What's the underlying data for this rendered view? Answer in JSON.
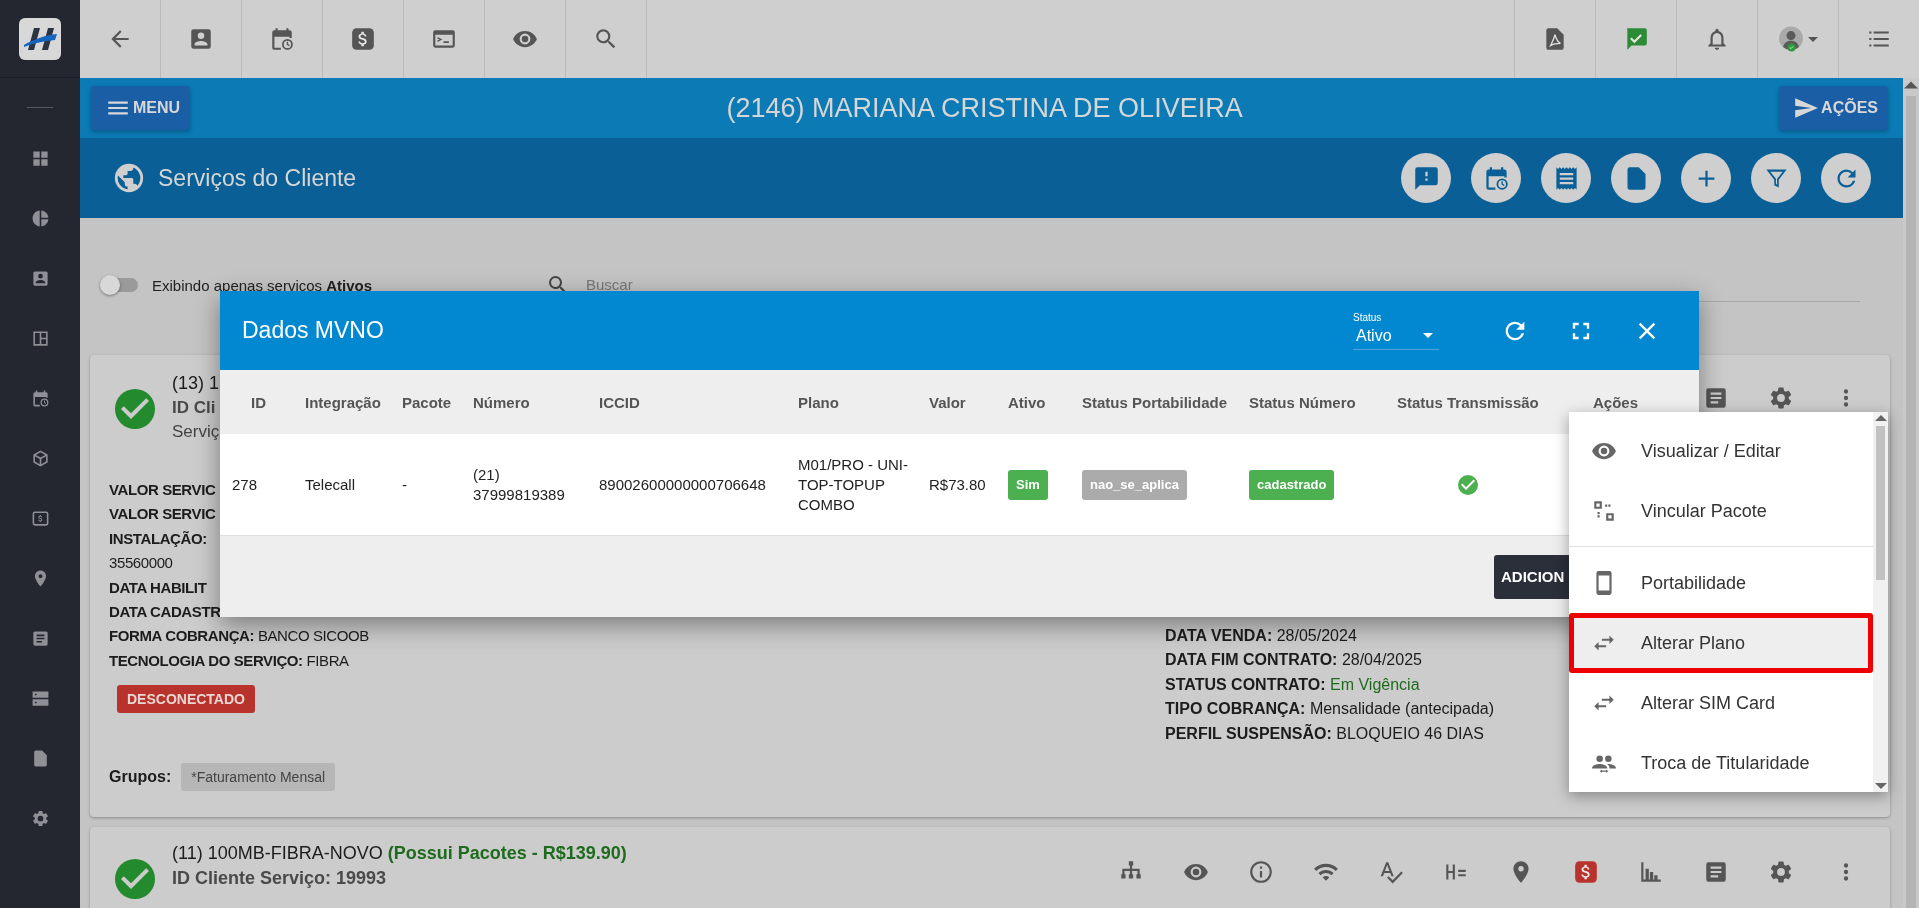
{
  "header": {
    "menu_button": "MENU",
    "title": "(2146) MARIANA CRISTINA DE OLIVEIRA",
    "actions_button": "AÇÕES"
  },
  "section": {
    "title": "Serviços do Cliente"
  },
  "filter": {
    "active_only": {
      "on": false,
      "label": "Exibindo apenas servicos **Ativos**"
    },
    "search": {
      "placeholder": "Buscar"
    }
  },
  "services": [
    {
      "title": "(13) 1",
      "id_line": "ID Cli",
      "subtitle": "Serviç",
      "details_left": [
        {
          "label": "VALOR SERVIC"
        },
        {
          "label": "VALOR SERVIC"
        },
        {
          "label": "INSTALAÇÃO:"
        },
        {
          "value": "35560000"
        },
        {
          "label": "DATA HABILIT"
        },
        {
          "label": "DATA CADASTR"
        },
        {
          "label": "FORMA COBRANÇA:",
          "value": "BANCO SICOOB"
        },
        {
          "label": "TECNOLOGIA DO SERVIÇO:",
          "value": "FIBRA"
        }
      ],
      "details_right": [
        {
          "label": "DATA VENDA:",
          "value": "28/05/2024",
          "highlight": false
        },
        {
          "label": "DATA FIM CONTRATO:",
          "value": "28/04/2025",
          "highlight": false
        },
        {
          "label": "STATUS CONTRATO:",
          "value": "Em Vigência",
          "highlight": true
        },
        {
          "label": "TIPO COBRANÇA:",
          "value": "Mensalidade (antecipada)",
          "highlight": false
        },
        {
          "label": "PERFIL SUSPENSÃO:",
          "value": "BLOQUEIO 46 DIAS",
          "highlight": false
        }
      ],
      "connection_badge": "DESCONECTADO",
      "groups_label": "Grupos:",
      "groups": [
        "*Faturamento Mensal"
      ]
    },
    {
      "title": "(11) 100MB-FIBRA-NOVO",
      "title_note": "(Possui Pacotes - R$139.90)",
      "id_line": "ID Cliente Serviço: 19993"
    }
  ],
  "modal": {
    "title": "Dados MVNO",
    "status_select": {
      "label": "Status",
      "value": "Ativo"
    },
    "columns": [
      "ID",
      "Integração",
      "Pacote",
      "Número",
      "ICCID",
      "Plano",
      "Valor",
      "Ativo",
      "Status Portabilidade",
      "Status Número",
      "Status Transmissão",
      "Ações"
    ],
    "rows": [
      {
        "cells": [
          {
            "kind": "text",
            "text": "278"
          },
          {
            "kind": "text",
            "text": "Telecall"
          },
          {
            "kind": "text",
            "text": "-"
          },
          {
            "kind": "text",
            "text": "(21) 37999819389"
          },
          {
            "kind": "text",
            "text": "89002600000000706648"
          },
          {
            "kind": "text",
            "text": "M01/PRO - UNI-TOP-TOPUP COMBO"
          },
          {
            "kind": "text",
            "text": "R$73.80"
          },
          {
            "kind": "badge",
            "text": "Sim",
            "color": "#4caf50"
          },
          {
            "kind": "badge",
            "text": "nao_se_aplica",
            "color": "#ababab"
          },
          {
            "kind": "badge",
            "text": "cadastrado",
            "color": "#4caf50"
          },
          {
            "kind": "check",
            "ok": true
          }
        ]
      }
    ],
    "add_button": "ADICION"
  },
  "context_menu": {
    "items": [
      {
        "kind": "view",
        "label": "Visualizar / Editar",
        "selected": false,
        "divider_after": false
      },
      {
        "kind": "link",
        "label": "Vincular Pacote",
        "selected": false,
        "divider_after": true
      },
      {
        "kind": "phone",
        "label": "Portabilidade",
        "selected": false,
        "divider_after": false
      },
      {
        "kind": "swap",
        "label": "Alterar Plano",
        "selected": true,
        "divider_after": false
      },
      {
        "kind": "swap",
        "label": "Alterar SIM Card",
        "selected": false,
        "divider_after": false
      },
      {
        "kind": "people",
        "label": "Troca de Titularidade",
        "selected": false,
        "divider_after": false
      }
    ]
  }
}
